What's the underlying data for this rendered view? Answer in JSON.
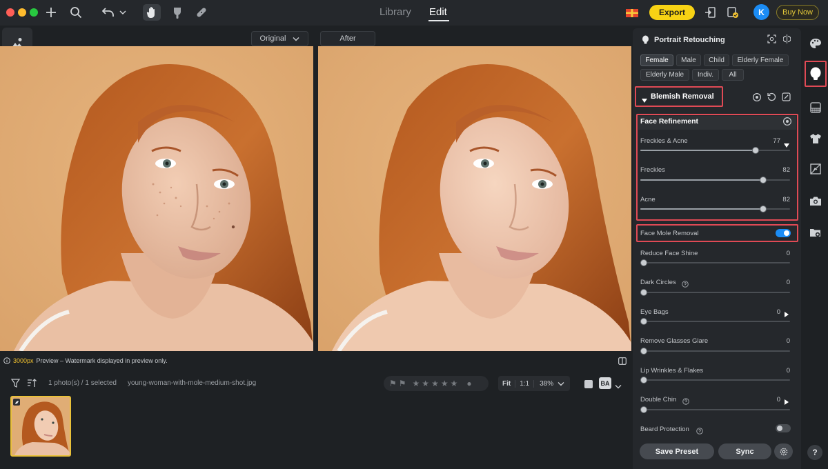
{
  "window": {
    "traffic_lights": [
      "#ff5f57",
      "#febc2e",
      "#28c840"
    ]
  },
  "toolbar": {
    "icons": [
      "plus-icon",
      "search-icon",
      "undo-icon",
      "chevron-down-icon",
      "hand-icon",
      "brush-icon",
      "bandage-icon"
    ]
  },
  "nav": {
    "tabs": [
      {
        "label": "Library",
        "active": false
      },
      {
        "label": "Edit",
        "active": true
      }
    ]
  },
  "header_right": {
    "export_label": "Export",
    "avatar_letter": "K",
    "buy_now_label": "Buy Now"
  },
  "compare": {
    "original_label": "Original",
    "after_label": "After"
  },
  "info": {
    "preview_size": "3000px",
    "preview_text": "Preview – Watermark displayed in preview only."
  },
  "filmstrip": {
    "count_text": "1 photo(s) / 1 selected",
    "filename": "young-woman-with-mole-medium-shot.jpg",
    "fit_label": "Fit",
    "one_to_one_label": "1:1",
    "zoom_value": "38%",
    "stars": 0,
    "ba_label": "BA"
  },
  "panel": {
    "title": "Portrait Retouching",
    "presets": [
      {
        "label": "Female",
        "active": true
      },
      {
        "label": "Male",
        "active": false
      },
      {
        "label": "Child",
        "active": false
      },
      {
        "label": "Elderly Female",
        "active": false
      },
      {
        "label": "Elderly Male",
        "active": false
      },
      {
        "label": "Indiv.",
        "active": false
      },
      {
        "label": "All",
        "active": false
      }
    ],
    "section_title": "Blemish Removal",
    "subsection_title": "Face Refinement",
    "sliders": [
      {
        "label": "Freckles & Acne",
        "value": "77",
        "fraction": 0.77
      },
      {
        "label": "Freckles",
        "value": "82",
        "fraction": 0.82
      },
      {
        "label": "Acne",
        "value": "82",
        "fraction": 0.82
      }
    ],
    "mole_removal": {
      "label": "Face Mole Removal",
      "on": true
    },
    "more_sliders": [
      {
        "label": "Reduce Face Shine",
        "value": "0",
        "fraction": 0
      },
      {
        "label": "Dark Circles",
        "value": "0",
        "fraction": 0
      },
      {
        "label": "Eye Bags",
        "value": "0",
        "fraction": 0
      },
      {
        "label": "Remove Glasses Glare",
        "value": "0",
        "fraction": 0
      },
      {
        "label": "Lip Wrinkles & Flakes",
        "value": "0",
        "fraction": 0
      },
      {
        "label": "Double Chin",
        "value": "0",
        "fraction": 0
      }
    ],
    "beard": {
      "label": "Beard Protection",
      "on": false
    },
    "save_preset_label": "Save Preset",
    "sync_label": "Sync"
  },
  "colors": {
    "accent_yellow": "#f7d214",
    "toggle_on": "#1b8cf5",
    "highlight_red": "#e04a55"
  },
  "help_label": "?"
}
